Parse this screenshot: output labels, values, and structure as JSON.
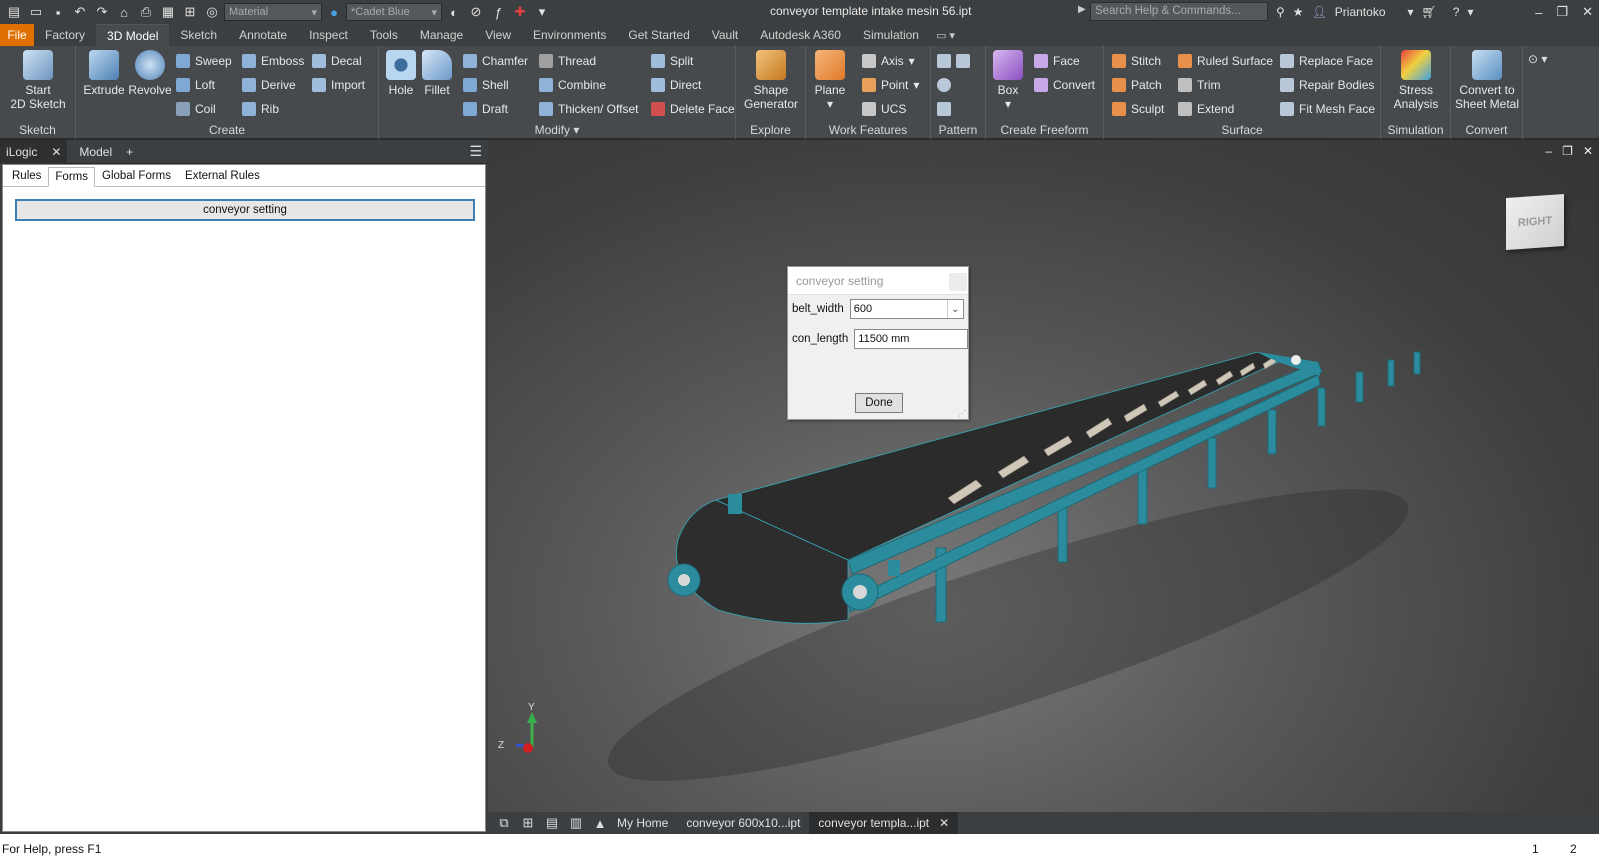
{
  "title_bar": {
    "document_title": "conveyor template intake mesin 56.ipt",
    "material_placeholder": "Material",
    "appearance": "*Cadet Blue",
    "search_placeholder": "Search Help & Commands...",
    "user": "Priantoko"
  },
  "ribbon_tabs": [
    "Factory",
    "3D Model",
    "Sketch",
    "Annotate",
    "Inspect",
    "Tools",
    "Manage",
    "View",
    "Environments",
    "Get Started",
    "Vault",
    "Autodesk A360",
    "Simulation"
  ],
  "ribbon_tab_active": "3D Model",
  "file_tab": "File",
  "ribbon": {
    "sketch": {
      "label": "Sketch",
      "start": "Start",
      "start2": "2D Sketch"
    },
    "create": {
      "label": "Create",
      "extrude": "Extrude",
      "revolve": "Revolve",
      "sweep": "Sweep",
      "emboss": "Emboss",
      "decal": "Decal",
      "loft": "Loft",
      "derive": "Derive",
      "import": "Import",
      "coil": "Coil",
      "rib": "Rib"
    },
    "modify": {
      "label": "Modify",
      "hole": "Hole",
      "fillet": "Fillet",
      "chamfer": "Chamfer",
      "thread": "Thread",
      "split": "Split",
      "shell": "Shell",
      "combine": "Combine",
      "direct": "Direct",
      "draft": "Draft",
      "thicken": "Thicken/ Offset",
      "delete_face": "Delete Face"
    },
    "explore": {
      "label": "Explore",
      "shape": "Shape",
      "generator": "Generator"
    },
    "work_features": {
      "label": "Work Features",
      "plane": "Plane",
      "axis": "Axis",
      "point": "Point",
      "ucs": "UCS"
    },
    "pattern": {
      "label": "Pattern"
    },
    "freeform": {
      "label": "Create Freeform",
      "box": "Box",
      "face": "Face",
      "convert": "Convert"
    },
    "surface": {
      "label": "Surface",
      "stitch": "Stitch",
      "ruled": "Ruled Surface",
      "replace": "Replace Face",
      "patch": "Patch",
      "trim": "Trim",
      "repair": "Repair Bodies",
      "sculpt": "Sculpt",
      "extend": "Extend",
      "fit_mesh": "Fit Mesh Face"
    },
    "simulation": {
      "label": "Simulation",
      "stress": "Stress",
      "analysis": "Analysis"
    },
    "convert": {
      "label": "Convert",
      "convert_to": "Convert to",
      "sheet_metal": "Sheet Metal"
    }
  },
  "browser": {
    "tab_ilogic": "iLogic",
    "tab_model": "Model",
    "subtabs": [
      "Rules",
      "Forms",
      "Global Forms",
      "External Rules"
    ],
    "subtab_active": "Forms",
    "form_button": "conveyor setting"
  },
  "dialog": {
    "title": "conveyor setting",
    "belt_width_label": "belt_width",
    "belt_width_value": "600",
    "con_length_label": "con_length",
    "con_length_value": "11500 mm",
    "done": "Done"
  },
  "viewcube_label": "RIGHT",
  "triad": {
    "z": "Z",
    "y": "Y"
  },
  "doc_tabs": {
    "home": "My Home",
    "tab1": "conveyor 600x10...ipt",
    "tab2": "conveyor templa...ipt"
  },
  "status": {
    "help": "For Help, press F1",
    "n1": "1",
    "n2": "2"
  },
  "colors": {
    "accent_orange": "#e06f00",
    "frame_cyan": "#2a8c9c",
    "belt": "#2a2a2a"
  }
}
